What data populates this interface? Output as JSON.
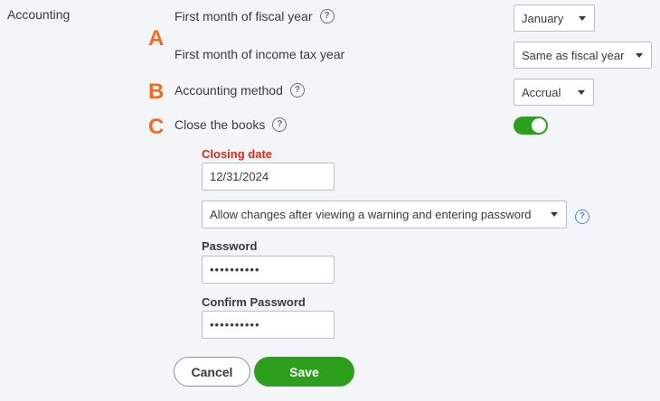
{
  "section": {
    "title": "Accounting"
  },
  "markers": {
    "a": "A",
    "b": "B",
    "c": "C"
  },
  "fiscal_year": {
    "label": "First month of fiscal year",
    "value": "January"
  },
  "income_tax_year": {
    "label": "First month of income tax year",
    "value": "Same as fiscal year"
  },
  "accounting_method": {
    "label": "Accounting method",
    "value": "Accrual"
  },
  "close_books": {
    "label": "Close the books",
    "enabled": true
  },
  "closing_date": {
    "label": "Closing date",
    "value": "12/31/2024"
  },
  "close_policy": {
    "value": "Allow changes after viewing a warning and entering password"
  },
  "password": {
    "label": "Password",
    "masked": "••••••••••"
  },
  "confirm_password": {
    "label": "Confirm Password",
    "masked": "••••••••••"
  },
  "buttons": {
    "cancel": "Cancel",
    "save": "Save"
  },
  "icons": {
    "help": "?"
  },
  "colors": {
    "marker": "#f26b21",
    "toggle_on": "#2ca01c",
    "save_button": "#2ca01c",
    "required_label": "#d52b1e"
  }
}
